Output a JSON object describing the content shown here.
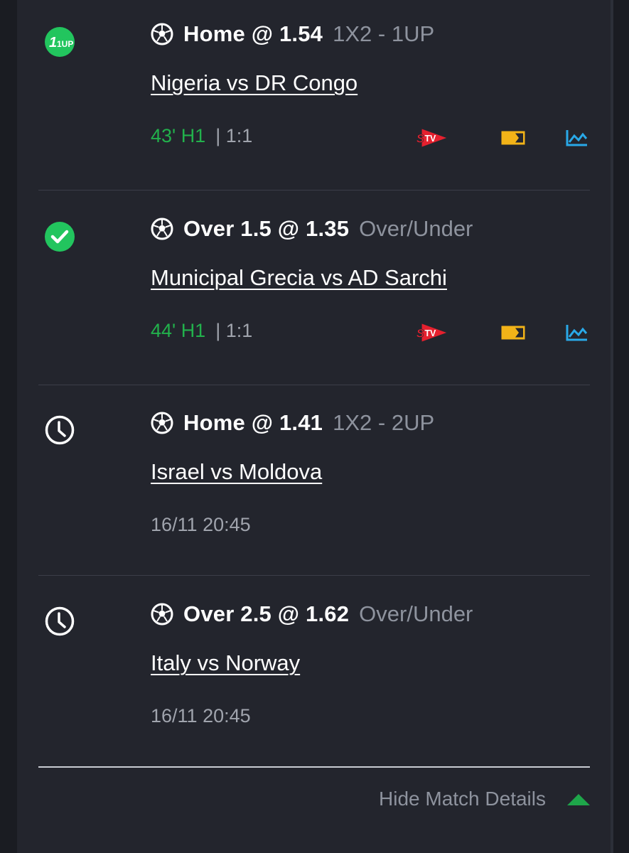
{
  "bets": [
    {
      "status_icon": "one-up-badge-icon",
      "status_text": "1UP",
      "selection": "Home @ 1.54",
      "market": "1X2 - 1UP",
      "match": "Nigeria vs DR Congo",
      "live_time": "43' H1",
      "score": "| 1:1",
      "icons": [
        "stv-icon",
        "scoreboard-icon",
        "stats-chart-icon"
      ]
    },
    {
      "status_icon": "check-circle-icon",
      "selection": "Over 1.5 @ 1.35",
      "market": "Over/Under",
      "match": "Municipal Grecia vs AD Sarchi",
      "live_time": "44' H1",
      "score": "| 1:1",
      "icons": [
        "stv-icon",
        "scoreboard-icon",
        "stats-chart-icon"
      ]
    },
    {
      "status_icon": "clock-icon",
      "selection": "Home @ 1.41",
      "market": "1X2 - 2UP",
      "match": "Israel vs Moldova",
      "kickoff": "16/11 20:45"
    },
    {
      "status_icon": "clock-icon",
      "selection": "Over 2.5 @ 1.62",
      "market": "Over/Under",
      "match": "Italy vs Norway",
      "kickoff": "16/11 20:45"
    }
  ],
  "footer": {
    "hide_label": "Hide Match Details"
  },
  "colors": {
    "live_green": "#22b14c",
    "accent_green": "#1ea64a",
    "stv_red": "#e5202e",
    "scoreboard_yellow": "#f2b318",
    "chart_blue": "#29a9e8"
  }
}
